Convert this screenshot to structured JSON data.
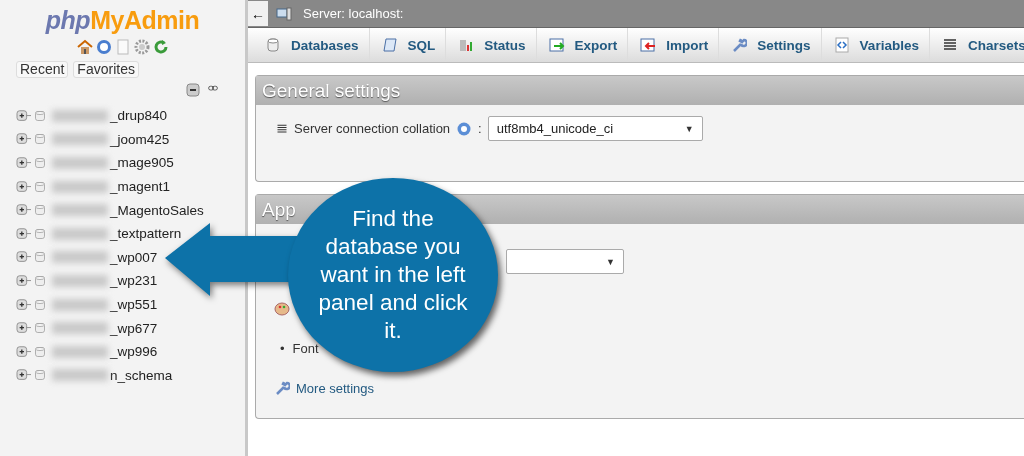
{
  "logo": {
    "prefix": "php",
    "name": "MyAdmin"
  },
  "sidebar": {
    "tabs": [
      {
        "label": "Recent"
      },
      {
        "label": "Favorites"
      }
    ],
    "databases": [
      {
        "name": "_drup840"
      },
      {
        "name": "_joom425"
      },
      {
        "name": "_mage905"
      },
      {
        "name": "_magent1"
      },
      {
        "name": "_MagentoSales"
      },
      {
        "name": "_textpattern"
      },
      {
        "name": "_wp007"
      },
      {
        "name": "_wp231"
      },
      {
        "name": "_wp551"
      },
      {
        "name": "_wp677"
      },
      {
        "name": "_wp996"
      },
      {
        "name": "n_schema"
      }
    ]
  },
  "topbar": {
    "back": "←",
    "title": "Server: localhost:"
  },
  "tabs": [
    {
      "label": "Databases"
    },
    {
      "label": "SQL"
    },
    {
      "label": "Status"
    },
    {
      "label": "Export"
    },
    {
      "label": "Import"
    },
    {
      "label": "Settings"
    },
    {
      "label": "Variables"
    },
    {
      "label": "Charsets"
    }
  ],
  "general_settings": {
    "title": "General settings",
    "label": "Server connection collation",
    "separator": ":",
    "value": "utf8mb4_unicode_ci",
    "arrow": "▼"
  },
  "appearance": {
    "title": "App",
    "select_arrow": "▼",
    "bullet": "•",
    "list_item": "Font",
    "link": "More settings"
  },
  "callout": {
    "text": "Find the database you want in the left panel and click it."
  }
}
